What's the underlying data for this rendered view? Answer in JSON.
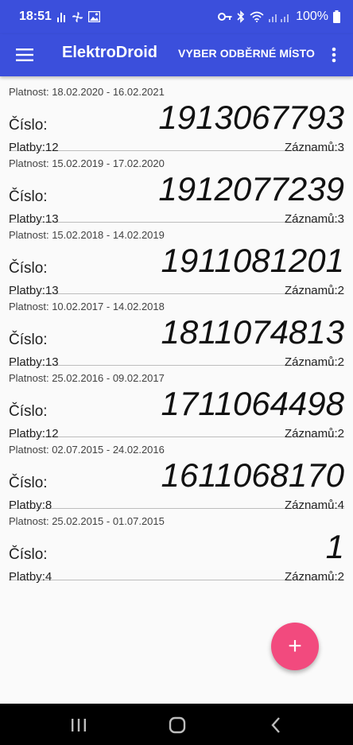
{
  "status_bar": {
    "time": "18:51",
    "battery": "100%",
    "icons_left": [
      "signal-bars-icon",
      "fan-icon",
      "image-icon"
    ],
    "icons_right": [
      "key-icon",
      "bluetooth-icon",
      "wifi-icon",
      "cell-signal-icon",
      "battery-icon"
    ]
  },
  "app_bar": {
    "title": "ElektroDroid",
    "action": "VYBER ODBĚRNÉ MÍSTO",
    "menu_icon": "hamburger-menu-icon",
    "overflow_icon": "more-vertical-icon"
  },
  "list": {
    "items": [
      {
        "validity": "Platnost: 18.02.2020 - 16.02.2021",
        "number_label": "Číslo:",
        "number": "1913067793",
        "payments": "Platby:12",
        "records": "Záznamů:3"
      },
      {
        "validity": "Platnost: 15.02.2019 - 17.02.2020",
        "number_label": "Číslo:",
        "number": "1912077239",
        "payments": "Platby:13",
        "records": "Záznamů:3"
      },
      {
        "validity": "Platnost: 15.02.2018 - 14.02.2019",
        "number_label": "Číslo:",
        "number": "1911081201",
        "payments": "Platby:13",
        "records": "Záznamů:2"
      },
      {
        "validity": "Platnost: 10.02.2017 - 14.02.2018",
        "number_label": "Číslo:",
        "number": "1811074813",
        "payments": "Platby:13",
        "records": "Záznamů:2"
      },
      {
        "validity": "Platnost: 25.02.2016 - 09.02.2017",
        "number_label": "Číslo:",
        "number": "1711064498",
        "payments": "Platby:12",
        "records": "Záznamů:2"
      },
      {
        "validity": "Platnost: 02.07.2015 - 24.02.2016",
        "number_label": "Číslo:",
        "number": "1611068170",
        "payments": "Platby:8",
        "records": "Záznamů:4"
      },
      {
        "validity": "Platnost: 25.02.2015 - 01.07.2015",
        "number_label": "Číslo:",
        "number": "1",
        "payments": "Platby:4",
        "records": "Záznamů:2"
      }
    ]
  },
  "fab": {
    "label": "+",
    "color": "#f24a7e"
  },
  "nav_bar": {
    "icons": [
      "recent-apps-icon",
      "home-icon",
      "back-icon"
    ]
  },
  "colors": {
    "primary": "#3b4fdc",
    "accent": "#f24a7e",
    "background": "#fafafa"
  }
}
